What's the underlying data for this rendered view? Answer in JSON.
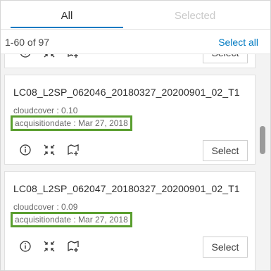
{
  "tabs": {
    "all_label": "All",
    "selected_label": "Selected"
  },
  "list_header": {
    "count_text": "1-60 of 97",
    "select_all_label": "Select all"
  },
  "cards": [
    {
      "title": "LC08_L2SP_062046_20180327_20200901_02_T1",
      "cloudcover": "cloudcover : 0.10",
      "acquisitiondate": "acquisitiondate : Mar 27, 2018",
      "select_label": "Select"
    },
    {
      "title": "LC08_L2SP_062047_20180327_20200901_02_T1",
      "cloudcover": "cloudcover : 0.09",
      "acquisitiondate": "acquisitiondate : Mar 27, 2018",
      "select_label": "Select"
    }
  ],
  "top_card": {
    "select_label": "Select"
  },
  "icons": [
    "info-icon",
    "zoom-to-icon",
    "add-to-map-icon"
  ],
  "colors": {
    "accent": "#007ac2",
    "highlight_border": "#5a9e2f"
  }
}
